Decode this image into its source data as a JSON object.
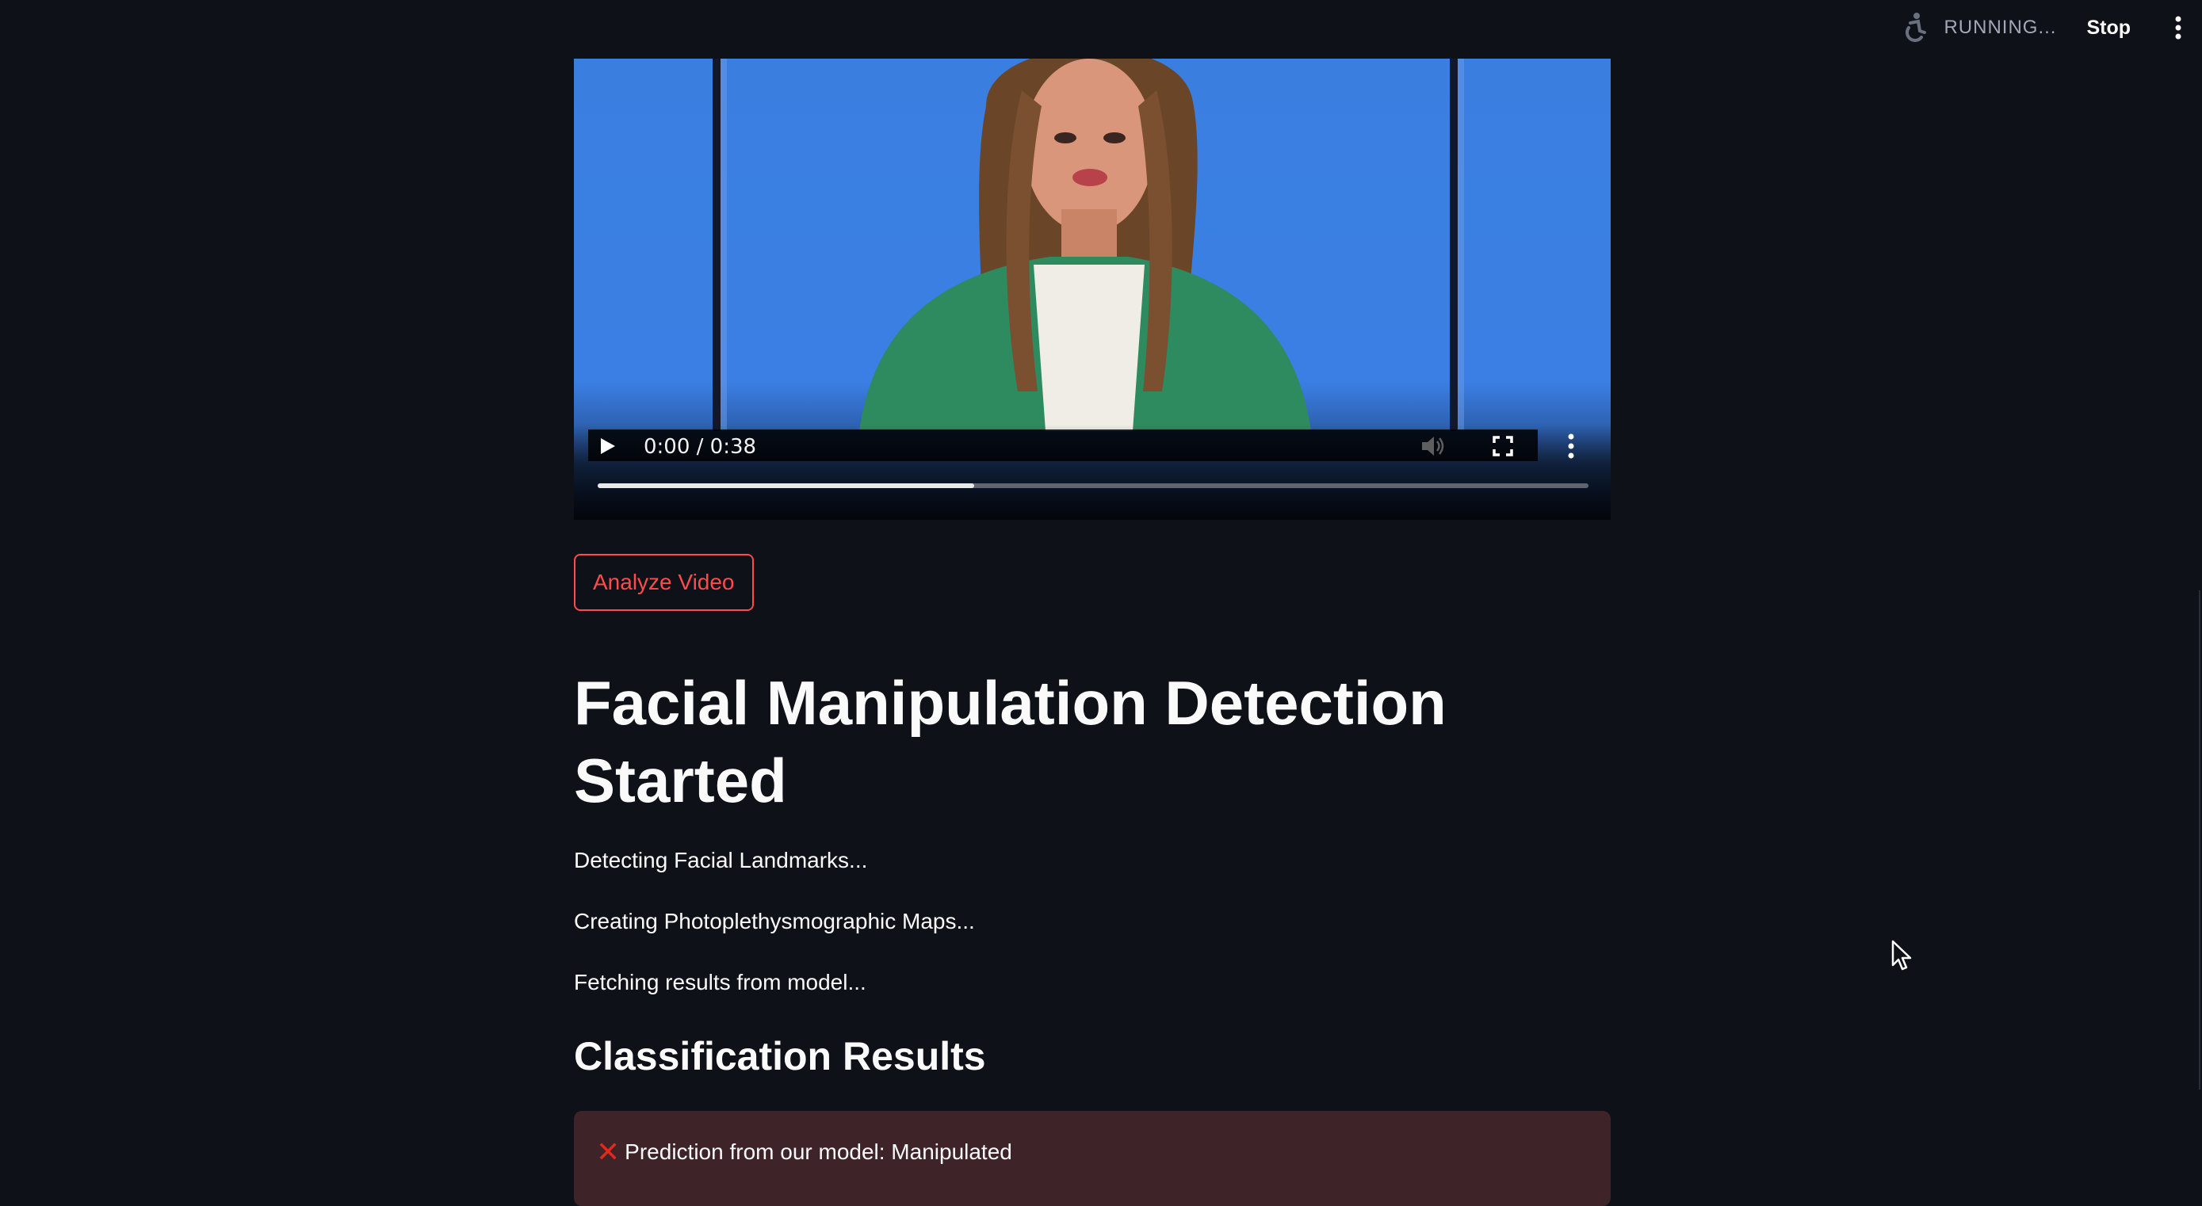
{
  "status": {
    "running_label": "RUNNING...",
    "stop_label": "Stop"
  },
  "video": {
    "time_label": "0:00 / 0:38",
    "progress_fraction": 0.38
  },
  "actions": {
    "analyze_label": "Analyze Video"
  },
  "main": {
    "title": "Facial Manipulation Detection Started",
    "steps": [
      "Detecting Facial Landmarks...",
      "Creating Photoplethysmographic Maps...",
      "Fetching results from model..."
    ],
    "results_heading": "Classification Results"
  },
  "result": {
    "icon": "cross-mark-icon",
    "text": "Prediction from our model: Manipulated"
  },
  "colors": {
    "background": "#0e1117",
    "accent": "#ff4b4b",
    "error_bg": "#3e2328",
    "video_blue": "#3b80e6"
  }
}
